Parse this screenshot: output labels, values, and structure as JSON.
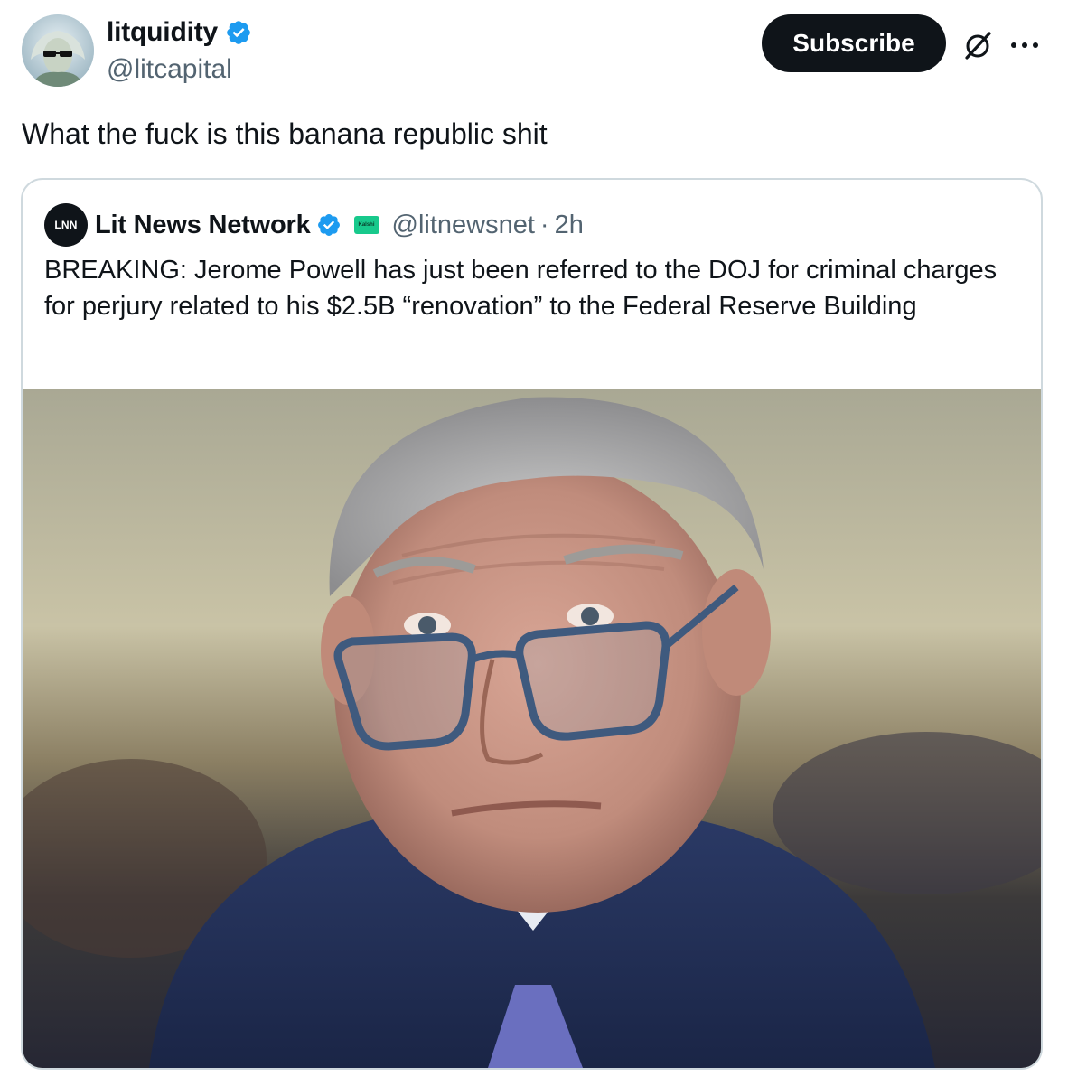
{
  "tweet": {
    "author": {
      "name": "litquidity",
      "handle": "@litcapital",
      "verified": true,
      "avatar": "sunglasses-portrait-avatar"
    },
    "actions": {
      "subscribe_label": "Subscribe",
      "grok_icon": "grok-icon",
      "more_icon": "more-icon"
    },
    "text": "What the fuck is this banana republic shit"
  },
  "quoted": {
    "author": {
      "avatar_text": "LNN",
      "name": "Lit News Network",
      "verified": true,
      "affiliate_badge_text": "Kalshi",
      "handle": "@litnewsnet",
      "separator": "·",
      "time": "2h"
    },
    "text": "BREAKING: Jerome Powell has just been referred to the DOJ for criminal charges for perjury related to his $2.5B “renovation” to the Federal Reserve Building",
    "media": "photo-man-with-blue-glasses-navy-suit"
  },
  "colors": {
    "text": "#0f1419",
    "secondary": "#536471",
    "verified": "#1d9bf0",
    "border": "#cfd9de",
    "subscribe_bg": "#0f1419",
    "affiliate": "#18c98c"
  }
}
